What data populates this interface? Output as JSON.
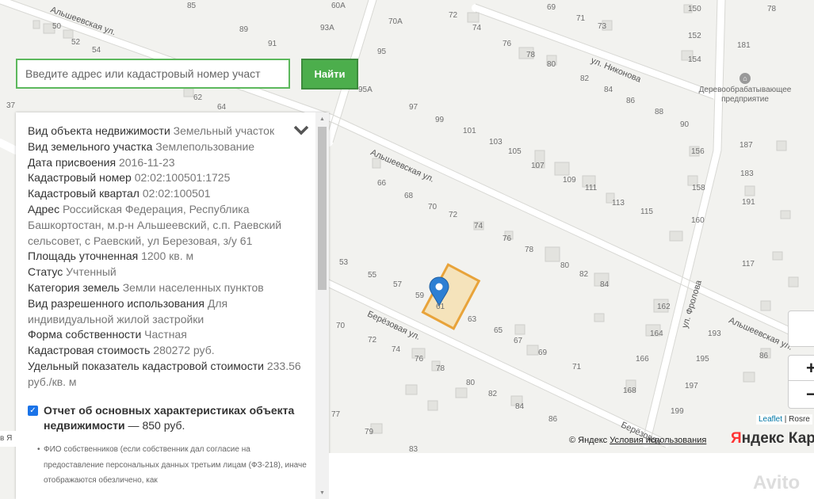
{
  "search": {
    "placeholder": "Введите адрес или кадастровый номер участ",
    "button_label": "Найти"
  },
  "info": {
    "rows": [
      {
        "key": "Вид объекта недвижимости",
        "value": "Земельный участок"
      },
      {
        "key": "Вид земельного участка",
        "value": "Землепользование"
      },
      {
        "key": "Дата присвоения",
        "value": "2016-11-23"
      },
      {
        "key": "Кадастровый номер",
        "value": "02:02:100501:1725"
      },
      {
        "key": "Кадастровый квартал",
        "value": "02:02:100501"
      },
      {
        "key": "Адрес",
        "value": "Российская Федерация, Республика Башкортостан, м.р-н Альшеевский, с.п. Раевский сельсовет, с Раевский, ул Березовая, з/у 61"
      },
      {
        "key": "Площадь уточненная",
        "value": "1200 кв. м"
      },
      {
        "key": "Статус",
        "value": "Учтенный"
      },
      {
        "key": "Категория земель",
        "value": "Земли населенных пунктов"
      },
      {
        "key": "Вид разрешенного использования",
        "value": "Для индивидуальной жилой застройки"
      },
      {
        "key": "Форма собственности",
        "value": "Частная"
      },
      {
        "key": "Кадастровая стоимость",
        "value": "280272 руб."
      },
      {
        "key": "Удельный показатель кадастровой стоимости",
        "value": "233.56 руб./кв. м"
      }
    ],
    "report": {
      "title": "Отчет об основных характеристиках объекта недвижимости",
      "price": " — 850 руб.",
      "note": "ФИО собственников (если собственник дал согласие на предоставление персональных данных третьим лицам (ФЗ-218), иначе отображаются обезличено, как"
    }
  },
  "map": {
    "streets": {
      "alsheevskaya_top": "Альшеевская ул.",
      "alsheevskaya_mid": "Альшеевская ул.",
      "alsheevskaya_right": "Альшеевская ул.",
      "nikonova": "ул. Никонова",
      "berezovaya": "Берёзовая ул.",
      "berezovaya_2": "Берёзовая",
      "frolova": "ул. Фролова"
    },
    "poi": "Деревообрабатывающее предприятие",
    "house_numbers": [
      {
        "t": "85"
      },
      {
        "t": "69"
      },
      {
        "t": "60А"
      },
      {
        "t": "72"
      },
      {
        "t": "71"
      },
      {
        "t": "150"
      },
      {
        "t": "78"
      },
      {
        "t": "50"
      },
      {
        "t": "52"
      },
      {
        "t": "89"
      },
      {
        "t": "93А"
      },
      {
        "t": "70А"
      },
      {
        "t": "74"
      },
      {
        "t": "73"
      },
      {
        "t": "152"
      },
      {
        "t": "54"
      },
      {
        "t": "91"
      },
      {
        "t": "95"
      },
      {
        "t": "76"
      },
      {
        "t": "78"
      },
      {
        "t": "80"
      },
      {
        "t": "154"
      },
      {
        "t": "181"
      },
      {
        "t": "95А"
      },
      {
        "t": "82"
      },
      {
        "t": "84"
      },
      {
        "t": "86"
      },
      {
        "t": "62"
      },
      {
        "t": "64"
      },
      {
        "t": "97"
      },
      {
        "t": "37"
      },
      {
        "t": "99"
      },
      {
        "t": "88"
      },
      {
        "t": "90"
      },
      {
        "t": "101"
      },
      {
        "t": "103"
      },
      {
        "t": "105"
      },
      {
        "t": "156"
      },
      {
        "t": "187"
      },
      {
        "t": "107"
      },
      {
        "t": "109"
      },
      {
        "t": "111"
      },
      {
        "t": "158"
      },
      {
        "t": "183"
      },
      {
        "t": "66"
      },
      {
        "t": "68"
      },
      {
        "t": "113"
      },
      {
        "t": "115"
      },
      {
        "t": "191"
      },
      {
        "t": "70"
      },
      {
        "t": "72"
      },
      {
        "t": "74"
      },
      {
        "t": "160"
      },
      {
        "t": "76"
      },
      {
        "t": "78"
      },
      {
        "t": "53"
      },
      {
        "t": "55"
      },
      {
        "t": "80"
      },
      {
        "t": "82"
      },
      {
        "t": "117"
      },
      {
        "t": "57"
      },
      {
        "t": "84"
      },
      {
        "t": "59"
      },
      {
        "t": "61"
      },
      {
        "t": "63"
      },
      {
        "t": "162"
      },
      {
        "t": "70"
      },
      {
        "t": "65"
      },
      {
        "t": "72"
      },
      {
        "t": "67"
      },
      {
        "t": "69"
      },
      {
        "t": "164"
      },
      {
        "t": "193"
      },
      {
        "t": "74"
      },
      {
        "t": "76"
      },
      {
        "t": "166"
      },
      {
        "t": "195"
      },
      {
        "t": "86"
      },
      {
        "t": "78"
      },
      {
        "t": "71"
      },
      {
        "t": "197"
      },
      {
        "t": "80"
      },
      {
        "t": "82"
      },
      {
        "t": "168"
      },
      {
        "t": "84"
      },
      {
        "t": "86"
      },
      {
        "t": "199"
      },
      {
        "t": "77"
      },
      {
        "t": "79"
      },
      {
        "t": "83"
      }
    ]
  },
  "controls": {
    "zoom_in": "+",
    "zoom_out": "−",
    "leaflet": "Leaflet",
    "rosreestr": " | Rosre",
    "yandex_copyright": "© Яндекс",
    "yandex_terms": "Условия использования",
    "yandex_logo_y": "Я",
    "yandex_logo_rest": "ндекс Карт",
    "left_crop": "в Я",
    "watermark": "Avito"
  },
  "colors": {
    "search_border": "#5cb85c",
    "button_bg": "#4cae4c",
    "parcel_border": "#e8a33a",
    "parcel_fill": "#f6d898",
    "pin": "#2d7fd3"
  }
}
